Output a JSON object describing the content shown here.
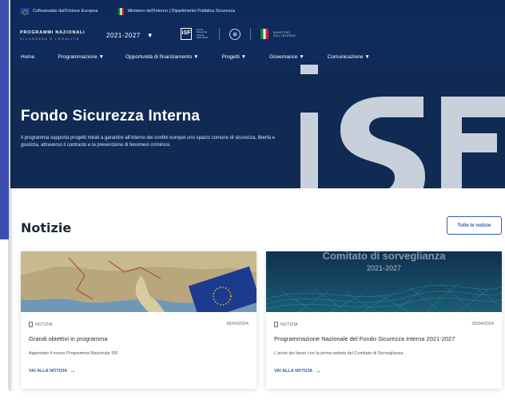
{
  "topbar": {
    "eu_text": "Cofinanziato dall'Unione Europea",
    "ministry_text": "Ministero dell'Interno | Dipartimento Pubblica Sicurezza"
  },
  "brand": {
    "programmi": "PROGRAMMI NAZIONALI",
    "sub": "SICUREZZA E LEGALITÀ",
    "period": "2021-2027",
    "isf_logo": "iSF",
    "isf_small": "Fondo Sicurezza Interna 2021-2027",
    "ministero": "MINISTERO DELL'INTERNO"
  },
  "nav": {
    "items": [
      {
        "label": "Home"
      },
      {
        "label": "Programmazione ▼"
      },
      {
        "label": "Opportunità di finanziamento ▼"
      },
      {
        "label": "Progetti ▼"
      },
      {
        "label": "Governance ▼"
      },
      {
        "label": "Comunicazione ▼"
      }
    ]
  },
  "hero": {
    "title": "Fondo Sicurezza Interna",
    "description": "Il programma supporta progetti mirati a garantire all'interno dei confini europei uno spazio comune di sicurezza, libertà e giustizia, attraverso il contrasto e la prevenzione di fenomeni criminosi.",
    "art_text": "iSF"
  },
  "news": {
    "heading": "Notizie",
    "all_button": "Tutte le notizie",
    "cards": [
      {
        "category": "NOTIZIA",
        "date": "05/04/2024",
        "title": "Grandi obiettivi in programma",
        "text": "Approvato il nuovo Programma Nazionale ISF",
        "link": "VAI ALLA NOTIZIA"
      },
      {
        "category": "NOTIZIA",
        "date": "05/04/2024",
        "title": "Programmazione Nazionale del Fondo Sicurezza Interna 2021-2027",
        "text": "L'avvio dei lavori con la prima seduta del Comitato di Sorveglianza",
        "link": "VAI ALLA NOTIZIA",
        "image_title": "Comitato di sorveglianza",
        "image_years": "2021-2027"
      }
    ]
  },
  "colors": {
    "navy": "#0f2b5c",
    "accent": "#2c5fae",
    "hero_letters": "#c8d0dc"
  }
}
